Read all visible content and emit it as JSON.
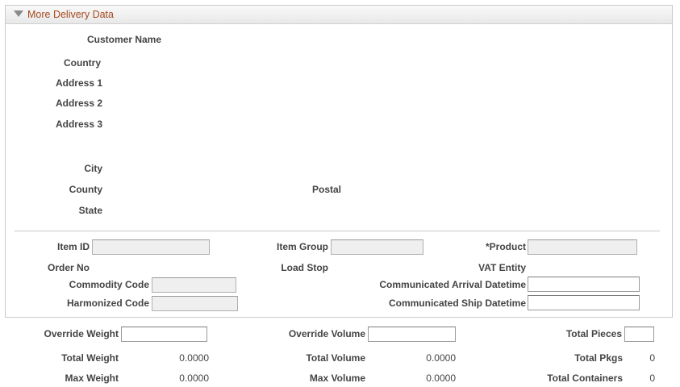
{
  "section": {
    "title": "More Delivery Data"
  },
  "address": {
    "customer_name_label": "Customer Name",
    "country_label": "Country",
    "address1_label": "Address 1",
    "address2_label": "Address 2",
    "address3_label": "Address 3",
    "city_label": "City",
    "county_label": "County",
    "postal_label": "Postal",
    "state_label": "State"
  },
  "details": {
    "item_id_label": "Item ID",
    "item_id_value": "",
    "item_group_label": "Item Group",
    "item_group_value": "",
    "product_label": "*Product",
    "product_value": "",
    "order_no_label": "Order No",
    "load_stop_label": "Load Stop",
    "vat_entity_label": "VAT Entity",
    "commodity_code_label": "Commodity Code",
    "commodity_code_value": "",
    "harmonized_code_label": "Harmonized Code",
    "harmonized_code_value": "",
    "comm_arrival_label": "Communicated Arrival Datetime",
    "comm_arrival_value": "",
    "comm_ship_label": "Communicated Ship Datetime",
    "comm_ship_value": ""
  },
  "totals": {
    "override_weight_label": "Override Weight",
    "override_weight_value": "",
    "override_volume_label": "Override Volume",
    "override_volume_value": "",
    "total_pieces_label": "Total Pieces",
    "total_pieces_value": "",
    "total_weight_label": "Total Weight",
    "total_weight_value": "0.0000",
    "total_volume_label": "Total Volume",
    "total_volume_value": "0.0000",
    "total_pkgs_label": "Total Pkgs",
    "total_pkgs_value": "0",
    "max_weight_label": "Max Weight",
    "max_weight_value": "0.0000",
    "max_volume_label": "Max Volume",
    "max_volume_value": "0.0000",
    "total_containers_label": "Total Containers",
    "total_containers_value": "0"
  }
}
